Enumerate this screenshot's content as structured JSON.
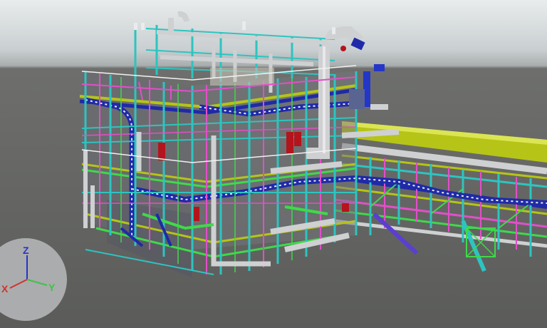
{
  "viewport": {
    "background_top": "#e9ecec",
    "background_ground": "#5b5c5a",
    "pipe_accent": "#b6c417",
    "structure_colors": [
      "#2ec4c0",
      "#1f2aa8",
      "#e24fc8",
      "#3fd94a",
      "#cfd0d2",
      "#b4141c"
    ]
  },
  "triad": {
    "x_label": "X",
    "y_label": "Y",
    "z_label": "Z",
    "x_color": "#d0342c",
    "y_color": "#3fc24a",
    "z_color": "#2436c8"
  }
}
